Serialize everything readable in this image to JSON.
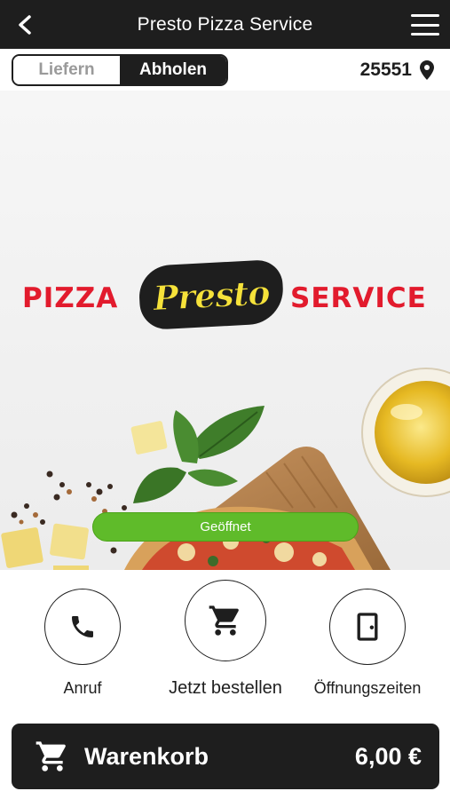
{
  "header": {
    "title": "Presto Pizza Service",
    "back_icon": "chevron-left-icon",
    "menu_icon": "hamburger-menu-icon"
  },
  "mode": {
    "options": [
      "Liefern",
      "Abholen"
    ],
    "selected": "Abholen"
  },
  "location": {
    "postal_code": "25551",
    "icon": "map-pin-icon"
  },
  "hero": {
    "logo": {
      "left_word": "PIZZA",
      "brand": "Presto",
      "right_word": "SERVICE"
    },
    "status": "Geöffnet"
  },
  "actions": [
    {
      "label": "Anruf",
      "icon": "phone-icon"
    },
    {
      "label": "Jetzt bestellen",
      "icon": "cart-icon"
    },
    {
      "label": "Öffnungszeiten",
      "icon": "door-icon"
    }
  ],
  "cart": {
    "label": "Warenkorb",
    "total": "6,00 €",
    "icon": "cart-icon"
  },
  "colors": {
    "dark": "#1e1e1e",
    "brand_red": "#e21b2d",
    "brand_yellow": "#f6e23a",
    "open_green": "#5fbb2a"
  }
}
